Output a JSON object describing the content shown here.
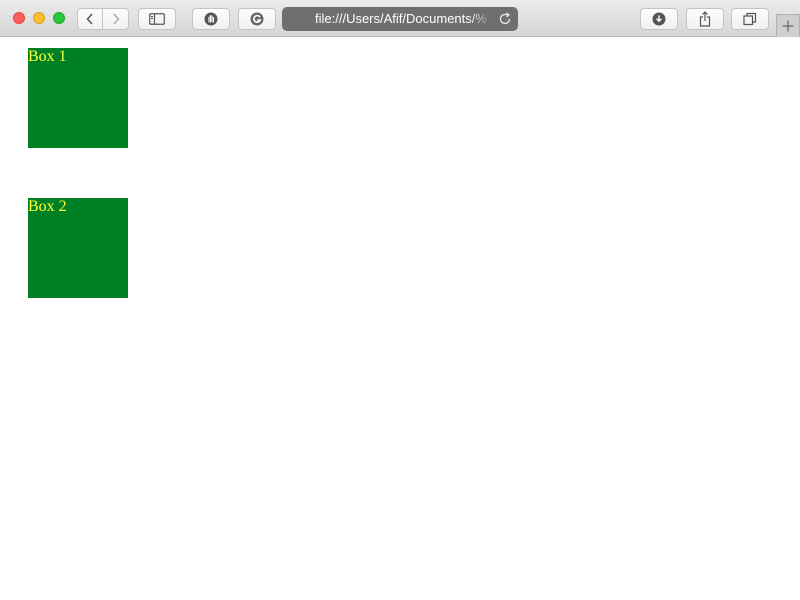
{
  "browser": {
    "url": "file:///Users/Afif/Documents/%",
    "icons": {
      "back": "chevron-left-icon",
      "forward": "chevron-right-icon",
      "sidebar": "sidebar-icon",
      "privacy": "hand-icon",
      "extension": "g-icon",
      "reload": "reload-icon",
      "downloads": "download-icon",
      "share": "share-icon",
      "tabs": "tabs-icon",
      "new_tab": "plus-icon"
    },
    "colors": {
      "close": "#fe5f57",
      "minimize": "#febc2e",
      "zoom": "#28c840"
    }
  },
  "page": {
    "boxes": [
      {
        "label": "Box 1"
      },
      {
        "label": "Box 2"
      }
    ],
    "colors": {
      "box_background": "#008024",
      "box_text": "#ffff33",
      "page_background": "#ffffff"
    }
  }
}
